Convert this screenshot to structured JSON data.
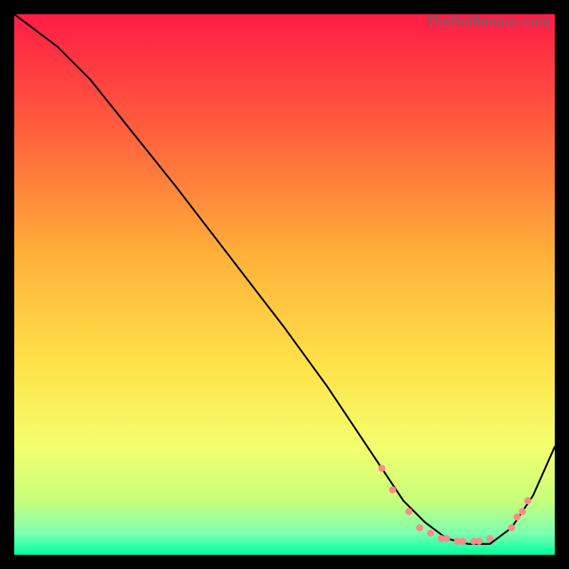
{
  "watermark": "TheBottleneck.com",
  "chart_data": {
    "type": "line",
    "title": "",
    "xlabel": "",
    "ylabel": "",
    "xlim": [
      0,
      100
    ],
    "ylim": [
      0,
      100
    ],
    "background_gradient": {
      "type": "vertical",
      "stops": [
        {
          "pct": 0,
          "color": "#ff1c46"
        },
        {
          "pct": 20,
          "color": "#ff5a3e"
        },
        {
          "pct": 45,
          "color": "#ffb23a"
        },
        {
          "pct": 65,
          "color": "#ffe24a"
        },
        {
          "pct": 80,
          "color": "#f4ff6e"
        },
        {
          "pct": 90,
          "color": "#c8ff7a"
        },
        {
          "pct": 96,
          "color": "#7dffb0"
        },
        {
          "pct": 100,
          "color": "#00ffa0"
        }
      ]
    },
    "series": [
      {
        "name": "bottleneck-curve",
        "color": "#000000",
        "x": [
          0,
          4,
          8,
          14,
          22,
          30,
          40,
          50,
          58,
          64,
          68,
          72,
          76,
          80,
          84,
          88,
          92,
          96,
          100
        ],
        "y": [
          100,
          97,
          94,
          88,
          78,
          68,
          55,
          42,
          31,
          22,
          16,
          10,
          6,
          3,
          2,
          2,
          5,
          11,
          20
        ]
      }
    ],
    "markers": {
      "name": "highlight-points",
      "color": "#ff8a8a",
      "points": [
        {
          "x": 68,
          "y": 16
        },
        {
          "x": 70,
          "y": 12
        },
        {
          "x": 73,
          "y": 8
        },
        {
          "x": 75,
          "y": 5
        },
        {
          "x": 77,
          "y": 4
        },
        {
          "x": 79,
          "y": 3
        },
        {
          "x": 80,
          "y": 3
        },
        {
          "x": 82,
          "y": 2.5
        },
        {
          "x": 83,
          "y": 2.5
        },
        {
          "x": 85,
          "y": 2.5
        },
        {
          "x": 86,
          "y": 2.5
        },
        {
          "x": 88,
          "y": 3
        },
        {
          "x": 92,
          "y": 5
        },
        {
          "x": 93,
          "y": 7
        },
        {
          "x": 94,
          "y": 8
        },
        {
          "x": 95,
          "y": 10
        }
      ]
    }
  }
}
